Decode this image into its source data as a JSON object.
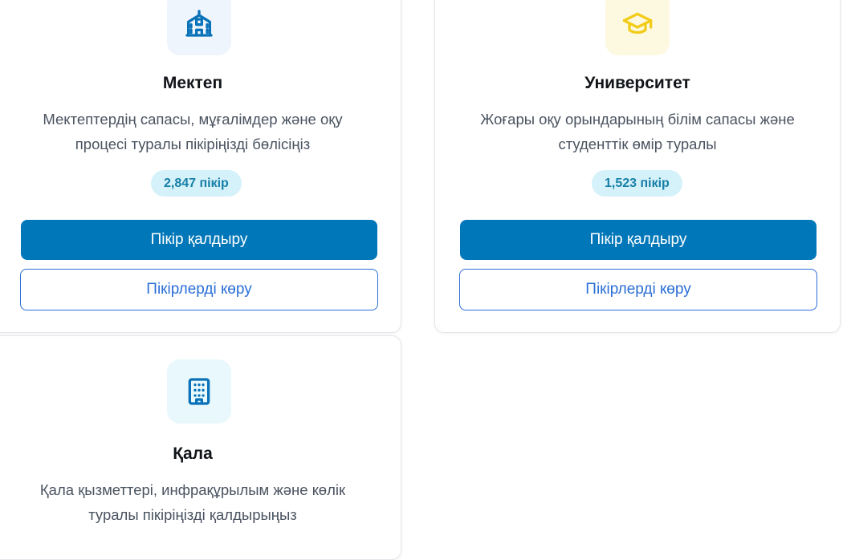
{
  "cards": [
    {
      "title": "Мектеп",
      "icon": "school-icon",
      "icon_bg": "#eef5fd",
      "icon_color": "#0a72b8",
      "description_lines": [
        "Мектептердің сапасы, мұғалімдер және оқу",
        "процесі туралы пікіріңізді бөлісіңіз"
      ],
      "count": "2,847 пікір",
      "primary_button": "Пікір қалдыру",
      "secondary_button": "Пікірлерді көру"
    },
    {
      "title": "Университет",
      "icon": "graduation-cap-icon",
      "icon_bg": "#fdf9e0",
      "icon_color": "#f2cc1a",
      "description_lines": [
        "Жоғары оқу орындарының білім сапасы және",
        "студенттік өмір туралы"
      ],
      "count": "1,523 пікір",
      "primary_button": "Пікір қалдыру",
      "secondary_button": "Пікірлерді көру"
    },
    {
      "title": "Қала",
      "icon": "building-icon",
      "icon_bg": "#e9f8fc",
      "icon_color": "#0a72b8",
      "description_lines": [
        "Қала қызметтері, инфрақұрылым және көлік",
        "туралы пікіріңізді қалдырыңыз"
      ]
    }
  ],
  "colors": {
    "primary": "#0077b8",
    "outline": "#2c6fd6",
    "badge_bg": "#d5f1f9",
    "badge_text": "#1880a8"
  }
}
